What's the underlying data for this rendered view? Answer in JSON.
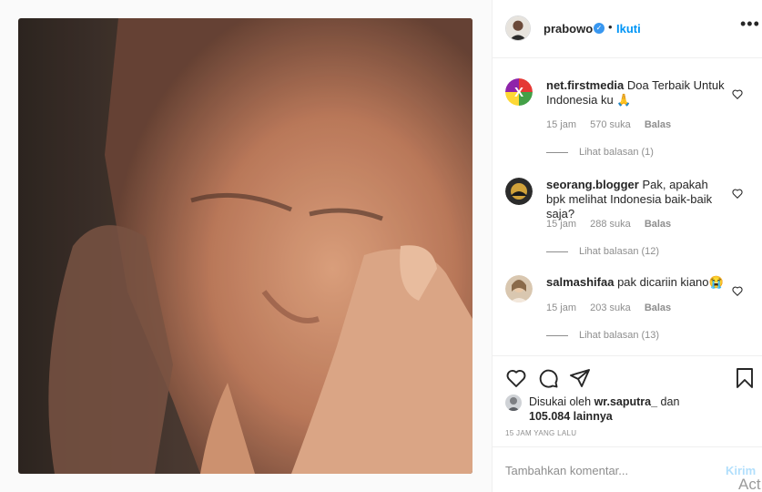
{
  "post": {
    "image_subject": "portrait-photo",
    "author": "prabowo",
    "verified_icon": "verified-badge-icon",
    "dot": "•",
    "follow_label": "Ikuti",
    "more_icon": "more-options-icon"
  },
  "comments": [
    {
      "username": "net.firstmedia",
      "text": "Doa Terbaik Untuk Indonesia ku 🙏",
      "time": "15 jam",
      "likes": "570 suka",
      "reply_label": "Balas",
      "view_replies": "Lihat balasan (1)"
    },
    {
      "username": "seorang.blogger",
      "text": "Pak, apakah bpk melihat Indonesia baik-baik saja?",
      "time": "15 jam",
      "likes": "288 suka",
      "reply_label": "Balas",
      "view_replies": "Lihat balasan (12)"
    },
    {
      "username": "salmashifaa",
      "text": "pak dicariin kiano😭",
      "time": "15 jam",
      "likes": "203 suka",
      "reply_label": "Balas",
      "view_replies": "Lihat balasan (13)"
    }
  ],
  "actions": {
    "like_icon": "heart-icon",
    "comment_icon": "comment-icon",
    "share_icon": "share-icon",
    "save_icon": "bookmark-icon"
  },
  "likes": {
    "prefix": "Disukai oleh",
    "user": "wr.saputra_",
    "conjunction": "dan",
    "count": "105.084 lainnya"
  },
  "timeago": "15 JAM YANG LALU",
  "composer": {
    "placeholder": "Tambahkan komentar...",
    "send_label": "Kirim"
  },
  "watermark": "Act",
  "colors": {
    "accent": "#0095f6",
    "send_disabled": "#b2dffc",
    "muted": "#8e8e8e",
    "text": "#262626"
  }
}
